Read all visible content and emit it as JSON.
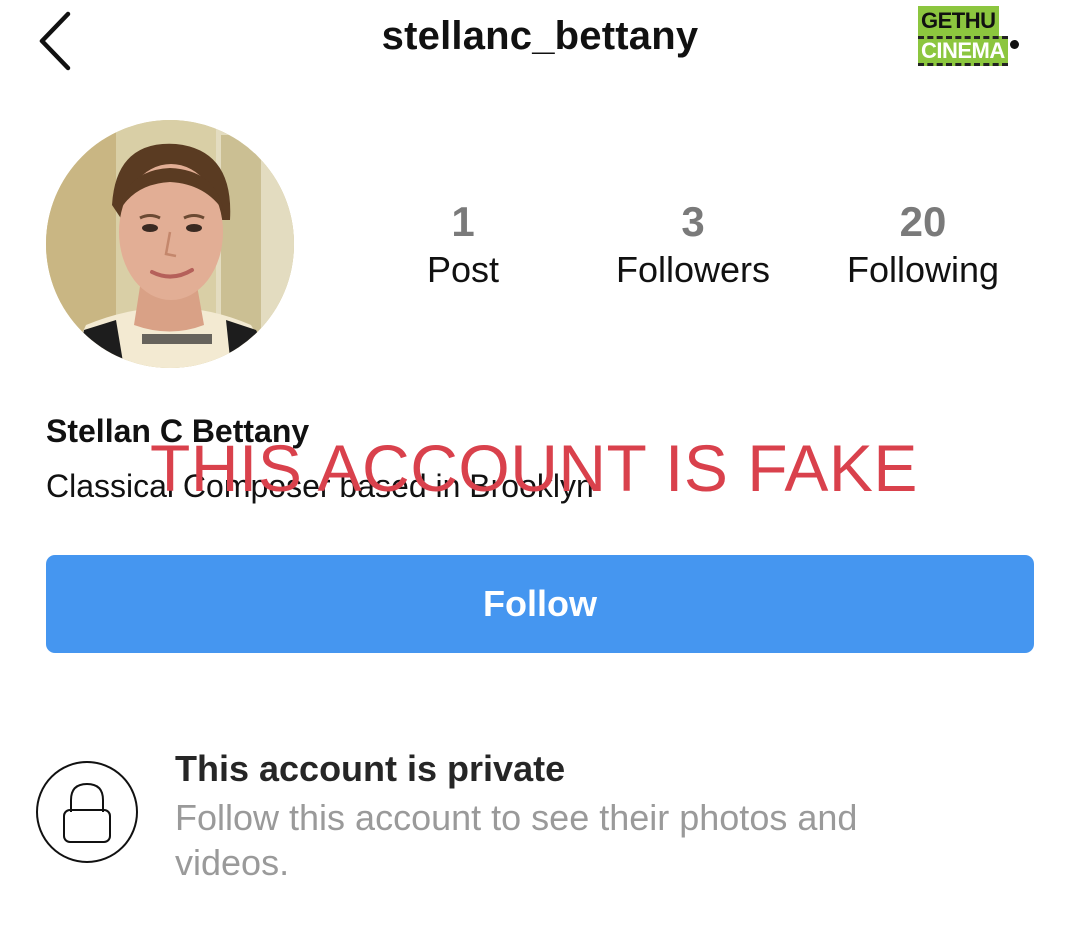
{
  "header": {
    "back_icon": "chevron-left-icon",
    "username": "stellanc_bettany",
    "more_icon": "more-dots-icon"
  },
  "watermark": {
    "left": "GETHU",
    "right": "CINEMA"
  },
  "profile": {
    "avatar": "profile-photo",
    "stats": [
      {
        "value": "1",
        "label": "Post"
      },
      {
        "value": "3",
        "label": "Followers"
      },
      {
        "value": "20",
        "label": "Following"
      }
    ],
    "full_name": "Stellan C Bettany",
    "bio": "Classical Composer based in Brooklyn"
  },
  "overlay": {
    "text": "THIS ACCOUNT IS FAKE",
    "color": "#d9414c"
  },
  "follow_button": {
    "label": "Follow",
    "color": "#4596f0"
  },
  "private_notice": {
    "icon": "lock-icon",
    "title": "This account is private",
    "description": "Follow this account to see their photos and videos."
  }
}
